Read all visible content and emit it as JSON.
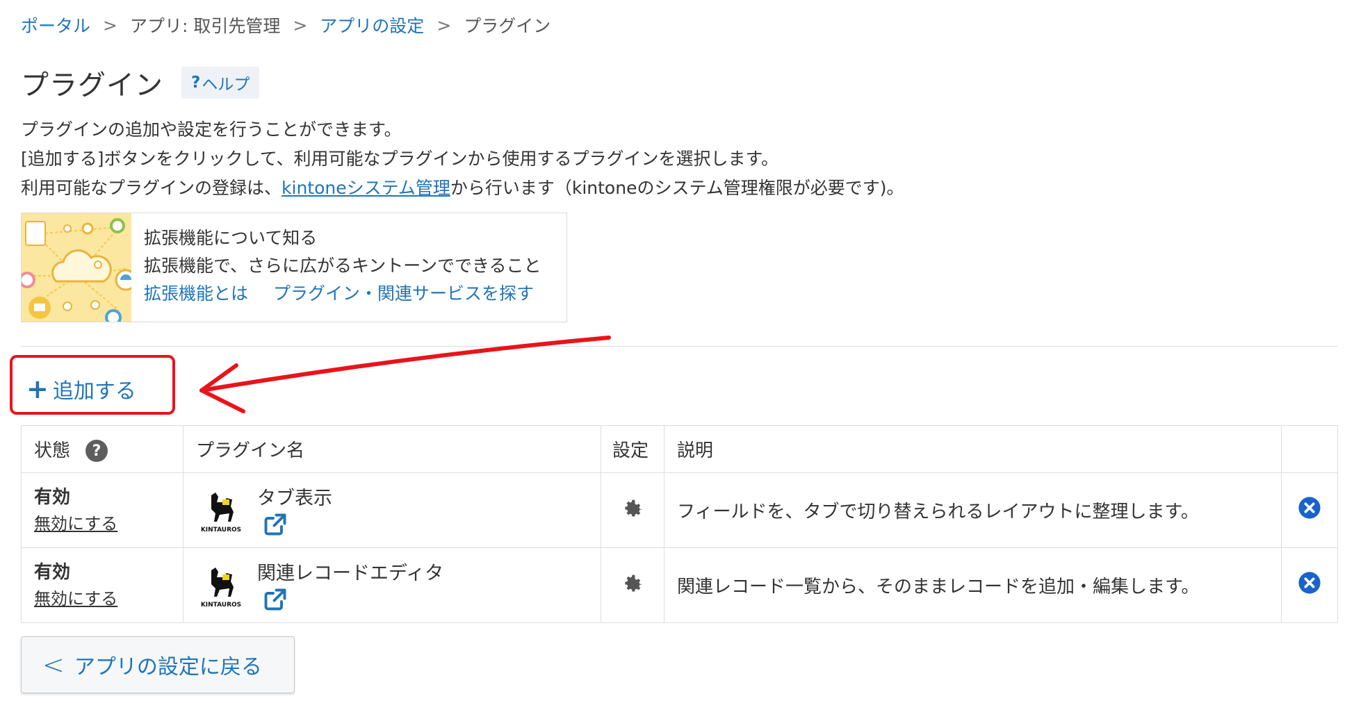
{
  "breadcrumb": {
    "portal": "ポータル",
    "app": "アプリ: 取引先管理",
    "app_settings": "アプリの設定",
    "current": "プラグイン",
    "separator": ">"
  },
  "page": {
    "title": "プラグイン",
    "help": "ヘルプ",
    "help_mark": "?"
  },
  "description": {
    "line1": "プラグインの追加や設定を行うことができます。",
    "line2": "[追加する]ボタンをクリックして、利用可能なプラグインから使用するプラグインを選択します。",
    "line3_prefix": "利用可能なプラグインの登録は、",
    "line3_link": "kintoneシステム管理",
    "line3_suffix": "から行います（kintoneのシステム管理権限が必要です)。"
  },
  "extension_card": {
    "heading": "拡張機能について知る",
    "subtitle": "拡張機能で、さらに広がるキントーンでできること",
    "link1": "拡張機能とは",
    "link2": "プラグイン・関連サービスを探す"
  },
  "add_button": {
    "plus": "+",
    "label": "追加する"
  },
  "table": {
    "headers": {
      "status": "状態",
      "status_help": "?",
      "name": "プラグイン名",
      "settings": "設定",
      "description": "説明"
    },
    "rows": [
      {
        "status": "有効",
        "disable": "無効にする",
        "name": "タブ表示",
        "description": "フィールドを、タブで切り替えられるレイアウトに整理します。",
        "logo_text": "KINTAUROS"
      },
      {
        "status": "有効",
        "disable": "無効にする",
        "name": "関連レコードエディタ",
        "description": "関連レコード一覧から、そのままレコードを追加・編集します。",
        "logo_text": "KINTAUROS"
      }
    ]
  },
  "back_button": {
    "chevron": "<",
    "label": "アプリの設定に戻る"
  },
  "colors": {
    "link": "#1f74b8",
    "annotation": "#e8141a",
    "delete": "#1a63c8"
  }
}
